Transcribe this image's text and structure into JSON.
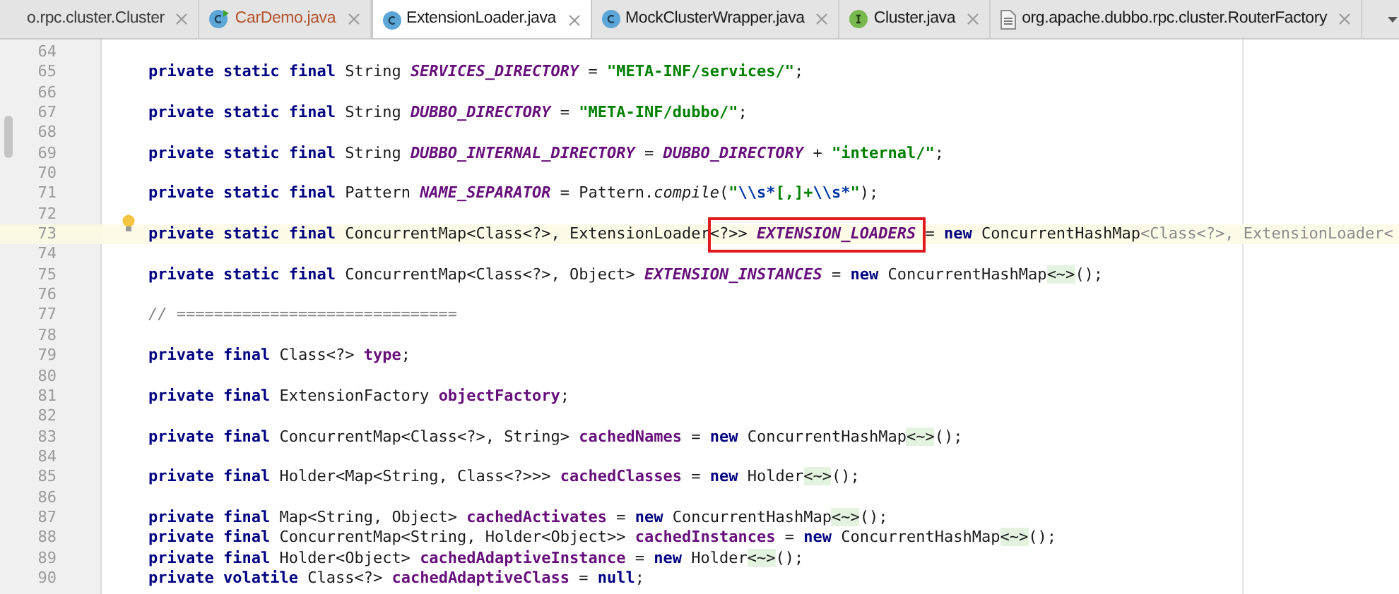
{
  "tabs": [
    {
      "label": "o.rpc.cluster.Cluster",
      "kind": "plain",
      "color": "#3a3a3a",
      "selected": false
    },
    {
      "label": "CarDemo.java",
      "kind": "runnable_class",
      "color": "#b5522a",
      "selected": false
    },
    {
      "label": "ExtensionLoader.java",
      "kind": "class",
      "color": "#1a1a1a",
      "selected": true
    },
    {
      "label": "MockClusterWrapper.java",
      "kind": "class",
      "color": "#1a1a1a",
      "selected": false
    },
    {
      "label": "Cluster.java",
      "kind": "interface",
      "color": "#1a1a1a",
      "selected": false
    },
    {
      "label": "org.apache.dubbo.rpc.cluster.RouterFactory",
      "kind": "file",
      "color": "#1a1a1a",
      "selected": false
    }
  ],
  "lines": [
    {
      "number": "64",
      "current": false,
      "bulb": false
    },
    {
      "number": "65",
      "current": false,
      "bulb": false,
      "tokens": [
        {
          "kind": "k",
          "text": "private static final "
        },
        {
          "kind": "t",
          "text": "String "
        },
        {
          "kind": "sf",
          "text": "SERVICES_DIRECTORY"
        },
        {
          "kind": "t",
          "text": " = "
        },
        {
          "kind": "s",
          "text": "\"META-INF/services/\""
        },
        {
          "kind": "t",
          "text": ";"
        }
      ]
    },
    {
      "number": "66",
      "current": false,
      "bulb": false
    },
    {
      "number": "67",
      "current": false,
      "bulb": false,
      "tokens": [
        {
          "kind": "k",
          "text": "private static final "
        },
        {
          "kind": "t",
          "text": "String "
        },
        {
          "kind": "sf",
          "text": "DUBBO_DIRECTORY"
        },
        {
          "kind": "t",
          "text": " = "
        },
        {
          "kind": "s",
          "text": "\"META-INF/dubbo/\""
        },
        {
          "kind": "t",
          "text": ";"
        }
      ]
    },
    {
      "number": "68",
      "current": false,
      "bulb": false
    },
    {
      "number": "69",
      "current": false,
      "bulb": false,
      "tokens": [
        {
          "kind": "k",
          "text": "private static final "
        },
        {
          "kind": "t",
          "text": "String "
        },
        {
          "kind": "sf",
          "text": "DUBBO_INTERNAL_DIRECTORY"
        },
        {
          "kind": "t",
          "text": " = "
        },
        {
          "kind": "sf",
          "text": "DUBBO_DIRECTORY"
        },
        {
          "kind": "t",
          "text": " + "
        },
        {
          "kind": "s",
          "text": "\"internal/\""
        },
        {
          "kind": "t",
          "text": ";"
        }
      ]
    },
    {
      "number": "70",
      "current": false,
      "bulb": false
    },
    {
      "number": "71",
      "current": false,
      "bulb": false,
      "tokens": [
        {
          "kind": "k",
          "text": "private static final "
        },
        {
          "kind": "t",
          "text": "Pattern "
        },
        {
          "kind": "sf",
          "text": "NAME_SEPARATOR"
        },
        {
          "kind": "t",
          "text": " = Pattern."
        },
        {
          "kind": "m",
          "text": "compile"
        },
        {
          "kind": "t",
          "text": "("
        },
        {
          "kind": "s",
          "text": "\""
        },
        {
          "kind": "e",
          "text": "\\\\s*"
        },
        {
          "kind": "s",
          "text": "[,]+"
        },
        {
          "kind": "e",
          "text": "\\\\s*"
        },
        {
          "kind": "s",
          "text": "\""
        },
        {
          "kind": "t",
          "text": ");"
        }
      ]
    },
    {
      "number": "72",
      "current": false,
      "bulb": true
    },
    {
      "number": "73",
      "current": true,
      "bulb": false,
      "tokens": [
        {
          "kind": "k",
          "text": "private static final "
        },
        {
          "kind": "t",
          "text": "ConcurrentMap<Class<?>, ExtensionLoader<?>> "
        },
        {
          "kind": "sf",
          "text": "EXTENSION_LOADERS",
          "boxed": true
        },
        {
          "kind": "t",
          "text": " = "
        },
        {
          "kind": "k",
          "text": "new"
        },
        {
          "kind": "t",
          "text": " ConcurrentHashMap"
        },
        {
          "kind": "g",
          "text": "<Class<?>, ExtensionLoader<"
        }
      ]
    },
    {
      "number": "74",
      "current": false,
      "bulb": false
    },
    {
      "number": "75",
      "current": false,
      "bulb": false,
      "tokens": [
        {
          "kind": "k",
          "text": "private static final "
        },
        {
          "kind": "t",
          "text": "ConcurrentMap<Class<?>, Object> "
        },
        {
          "kind": "sf",
          "text": "EXTENSION_INSTANCES"
        },
        {
          "kind": "t",
          "text": " = "
        },
        {
          "kind": "k",
          "text": "new"
        },
        {
          "kind": "t",
          "text": " ConcurrentHashMap"
        },
        {
          "kind": "d",
          "text": "<~>"
        },
        {
          "kind": "t",
          "text": "();"
        }
      ]
    },
    {
      "number": "76",
      "current": false,
      "bulb": false
    },
    {
      "number": "77",
      "current": false,
      "bulb": false,
      "tokens": [
        {
          "kind": "c",
          "text": "// =============================="
        }
      ]
    },
    {
      "number": "78",
      "current": false,
      "bulb": false
    },
    {
      "number": "79",
      "current": false,
      "bulb": false,
      "tokens": [
        {
          "kind": "k",
          "text": "private final "
        },
        {
          "kind": "t",
          "text": "Class<?> "
        },
        {
          "kind": "f",
          "text": "type"
        },
        {
          "kind": "t",
          "text": ";"
        }
      ]
    },
    {
      "number": "80",
      "current": false,
      "bulb": false
    },
    {
      "number": "81",
      "current": false,
      "bulb": false,
      "tokens": [
        {
          "kind": "k",
          "text": "private final "
        },
        {
          "kind": "t",
          "text": "ExtensionFactory "
        },
        {
          "kind": "f",
          "text": "objectFactory"
        },
        {
          "kind": "t",
          "text": ";"
        }
      ]
    },
    {
      "number": "82",
      "current": false,
      "bulb": false
    },
    {
      "number": "83",
      "current": false,
      "bulb": false,
      "tokens": [
        {
          "kind": "k",
          "text": "private final "
        },
        {
          "kind": "t",
          "text": "ConcurrentMap<Class<?>, String> "
        },
        {
          "kind": "f",
          "text": "cachedNames"
        },
        {
          "kind": "t",
          "text": " = "
        },
        {
          "kind": "k",
          "text": "new"
        },
        {
          "kind": "t",
          "text": " ConcurrentHashMap"
        },
        {
          "kind": "d",
          "text": "<~>"
        },
        {
          "kind": "t",
          "text": "();"
        }
      ]
    },
    {
      "number": "84",
      "current": false,
      "bulb": false
    },
    {
      "number": "85",
      "current": false,
      "bulb": false,
      "tokens": [
        {
          "kind": "k",
          "text": "private final "
        },
        {
          "kind": "t",
          "text": "Holder<Map<String, Class<?>>> "
        },
        {
          "kind": "f",
          "text": "cachedClasses"
        },
        {
          "kind": "t",
          "text": " = "
        },
        {
          "kind": "k",
          "text": "new"
        },
        {
          "kind": "t",
          "text": " Holder"
        },
        {
          "kind": "d",
          "text": "<~>"
        },
        {
          "kind": "t",
          "text": "();"
        }
      ]
    },
    {
      "number": "86",
      "current": false,
      "bulb": false
    },
    {
      "number": "87",
      "current": false,
      "bulb": false,
      "tokens": [
        {
          "kind": "k",
          "text": "private final "
        },
        {
          "kind": "t",
          "text": "Map<String, Object> "
        },
        {
          "kind": "f",
          "text": "cachedActivates"
        },
        {
          "kind": "t",
          "text": " = "
        },
        {
          "kind": "k",
          "text": "new"
        },
        {
          "kind": "t",
          "text": " ConcurrentHashMap"
        },
        {
          "kind": "d",
          "text": "<~>"
        },
        {
          "kind": "t",
          "text": "();"
        }
      ]
    },
    {
      "number": "88",
      "current": false,
      "bulb": false,
      "tokens": [
        {
          "kind": "k",
          "text": "private final "
        },
        {
          "kind": "t",
          "text": "ConcurrentMap<String, Holder<Object>> "
        },
        {
          "kind": "f",
          "text": "cachedInstances"
        },
        {
          "kind": "t",
          "text": " = "
        },
        {
          "kind": "k",
          "text": "new"
        },
        {
          "kind": "t",
          "text": " ConcurrentHashMap"
        },
        {
          "kind": "d",
          "text": "<~>"
        },
        {
          "kind": "t",
          "text": "();"
        }
      ]
    },
    {
      "number": "89",
      "current": false,
      "bulb": false,
      "tokens": [
        {
          "kind": "k",
          "text": "private final "
        },
        {
          "kind": "t",
          "text": "Holder<Object> "
        },
        {
          "kind": "f",
          "text": "cachedAdaptiveInstance"
        },
        {
          "kind": "t",
          "text": " = "
        },
        {
          "kind": "k",
          "text": "new"
        },
        {
          "kind": "t",
          "text": " Holder"
        },
        {
          "kind": "d",
          "text": "<~>"
        },
        {
          "kind": "t",
          "text": "();"
        }
      ]
    },
    {
      "number": "90",
      "current": false,
      "bulb": false,
      "tokens": [
        {
          "kind": "k",
          "text": "private volatile "
        },
        {
          "kind": "t",
          "text": "Class<?> "
        },
        {
          "kind": "f",
          "text": "cachedAdaptiveClass"
        },
        {
          "kind": "t",
          "text": " = "
        },
        {
          "kind": "k",
          "text": "null"
        },
        {
          "kind": "t",
          "text": ";"
        }
      ]
    }
  ]
}
